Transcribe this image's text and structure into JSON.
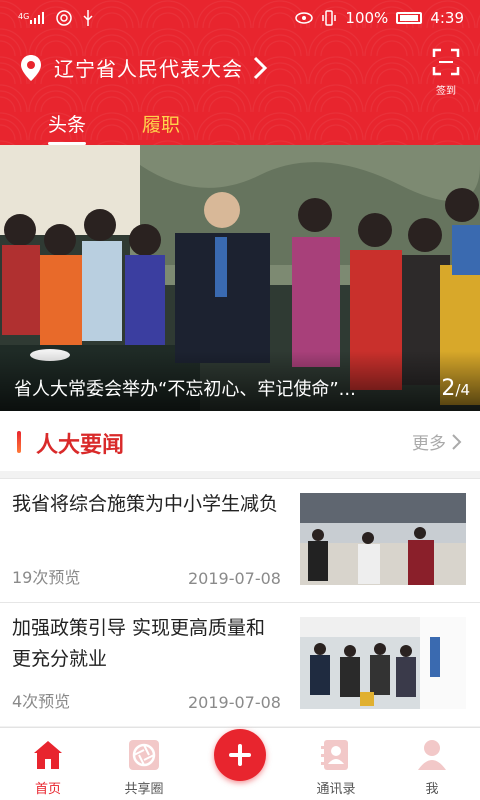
{
  "status_bar": {
    "left_signal_label": "4G",
    "battery_percent": "100%",
    "time": "4:39"
  },
  "header": {
    "location": "辽宁省人民代表大会",
    "checkin_label": "签到",
    "tabs": [
      {
        "label": "头条",
        "active": true
      },
      {
        "label": "履职",
        "active": false
      }
    ],
    "colors": {
      "primary": "#e8252e",
      "inactive_tab": "#ffd24c"
    }
  },
  "banner": {
    "title": "省人大常委会举办“不忘初心、牢记使命”...",
    "current_page": "2",
    "total_pages": "/4"
  },
  "section": {
    "title": "人大要闻",
    "more_label": "更多"
  },
  "news": [
    {
      "title": "我省将综合施策为中小学生减负",
      "views": "19次预览",
      "date": "2019-07-08"
    },
    {
      "title": "加强政策引导 实现更高质量和更充分就业",
      "views": "4次预览",
      "date": "2019-07-08"
    }
  ],
  "bottom_nav": [
    {
      "label": "首页",
      "icon": "home-icon",
      "active": true
    },
    {
      "label": "共享圈",
      "icon": "shutter-icon",
      "active": false
    },
    {
      "label": "",
      "icon": "plus-icon",
      "active": false
    },
    {
      "label": "通讯录",
      "icon": "contacts-icon",
      "active": false
    },
    {
      "label": "我",
      "icon": "user-icon",
      "active": false
    }
  ]
}
